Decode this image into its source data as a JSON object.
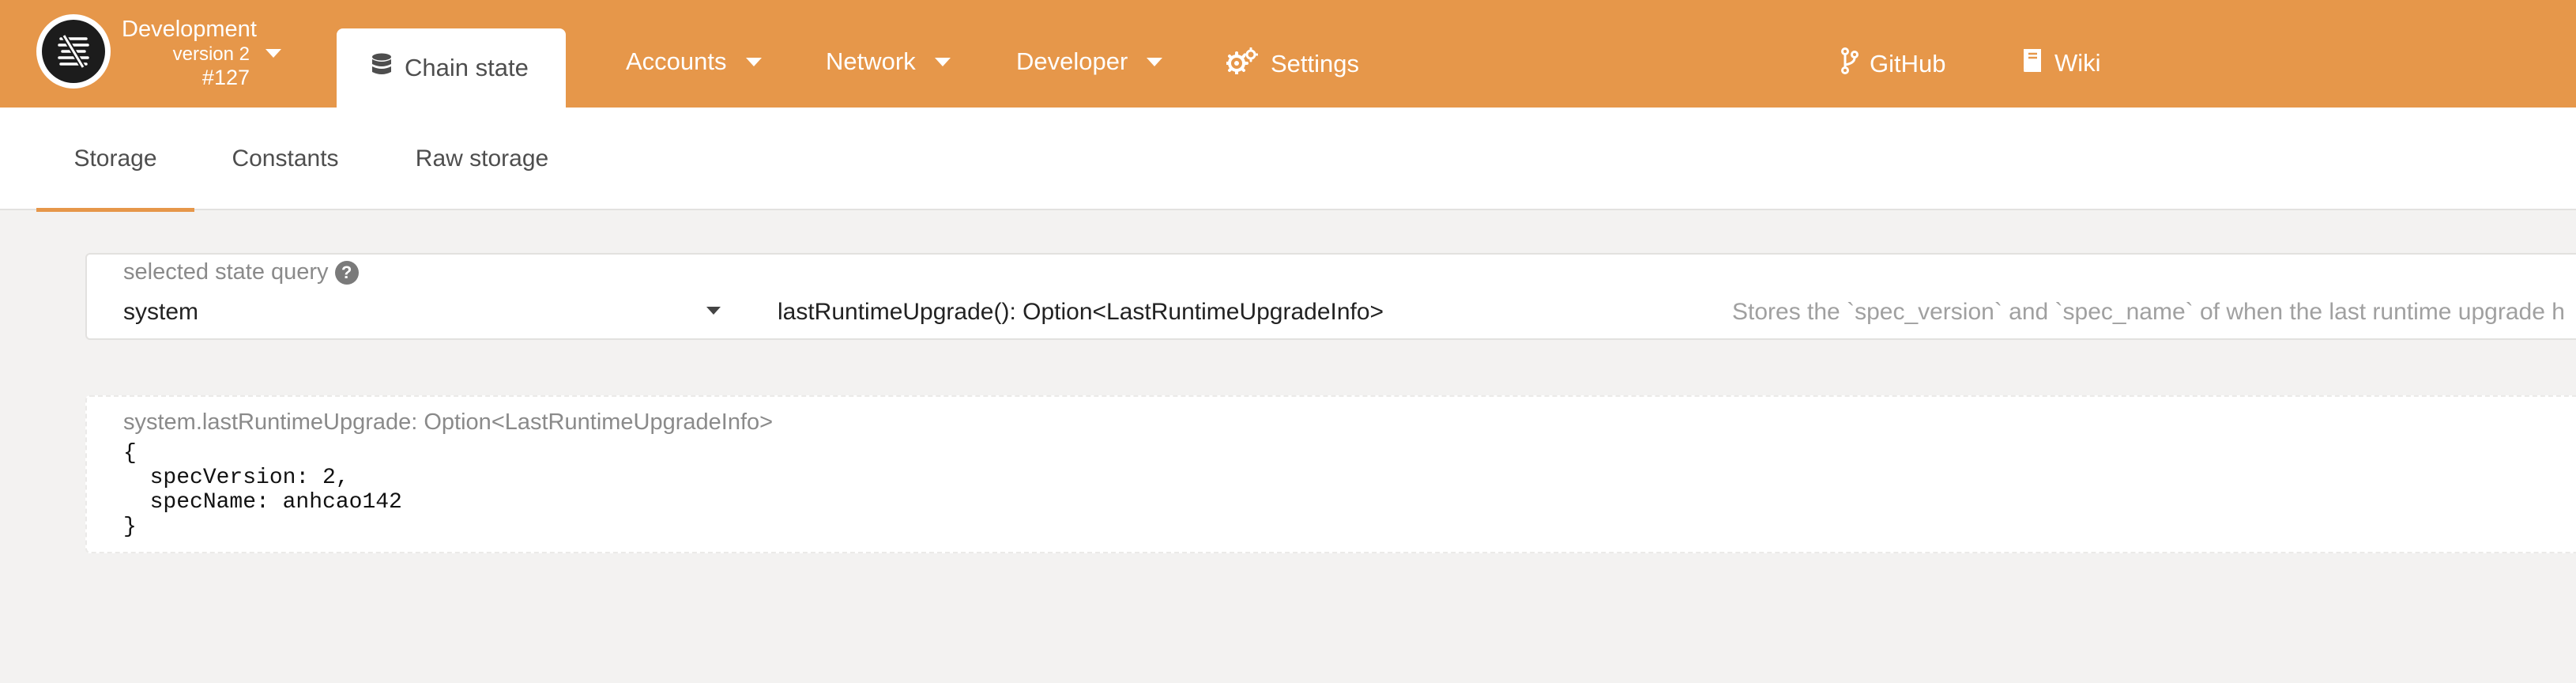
{
  "header": {
    "chain_name": "Development",
    "version": "version 2",
    "block": "#127",
    "active_tab": "Chain state",
    "nav": [
      {
        "label": "Accounts"
      },
      {
        "label": "Network"
      },
      {
        "label": "Developer"
      },
      {
        "label": "Settings"
      },
      {
        "label": "GitHub"
      },
      {
        "label": "Wiki"
      }
    ],
    "accent_color": "#e6974a"
  },
  "subtabs": [
    {
      "label": "Storage",
      "active": true
    },
    {
      "label": "Constants",
      "active": false
    },
    {
      "label": "Raw storage",
      "active": false
    }
  ],
  "query": {
    "label": "selected state query",
    "module": "system",
    "method": "lastRuntimeUpgrade(): Option<LastRuntimeUpgradeInfo>",
    "doc": "Stores the `spec_version` and `spec_name` of when the last runtime upgrade h"
  },
  "result": {
    "label": "system.lastRuntimeUpgrade: Option<LastRuntimeUpgradeInfo>",
    "value": "{\n  specVersion: 2,\n  specName: anhcao142\n}"
  }
}
